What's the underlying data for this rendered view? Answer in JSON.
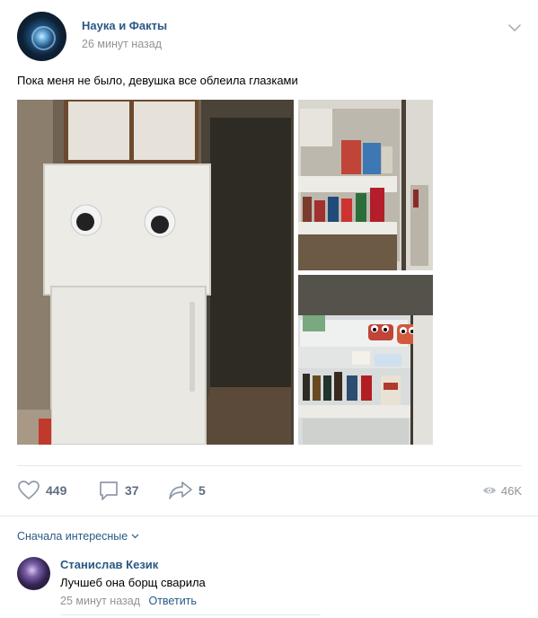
{
  "post": {
    "author": "Наука и Факты",
    "time": "26 минут назад",
    "text": "Пока меня не было, девушка все облеила глазками",
    "photos": [
      {
        "subject": "refrigerator with googly eyes"
      },
      {
        "subject": "open refrigerator door shelves"
      },
      {
        "subject": "refrigerator interior with googly eyes"
      }
    ]
  },
  "actions": {
    "likes": "449",
    "comments": "37",
    "shares": "5",
    "views": "46K"
  },
  "comments_section": {
    "sort_label": "Сначала интересные"
  },
  "comment": {
    "author": "Станислав Кезик",
    "text": "Лучшеб она борщ сварила",
    "time": "25 минут назад",
    "reply_label": "Ответить"
  },
  "icons": {
    "more": "chevron-down-icon",
    "like": "heart-icon",
    "comment": "comment-bubble-icon",
    "share": "share-arrow-icon",
    "views": "eye-icon"
  },
  "colors": {
    "link": "#2a5885",
    "muted": "#939393",
    "action": "#5e6e80",
    "divider": "#e7e8ec"
  }
}
